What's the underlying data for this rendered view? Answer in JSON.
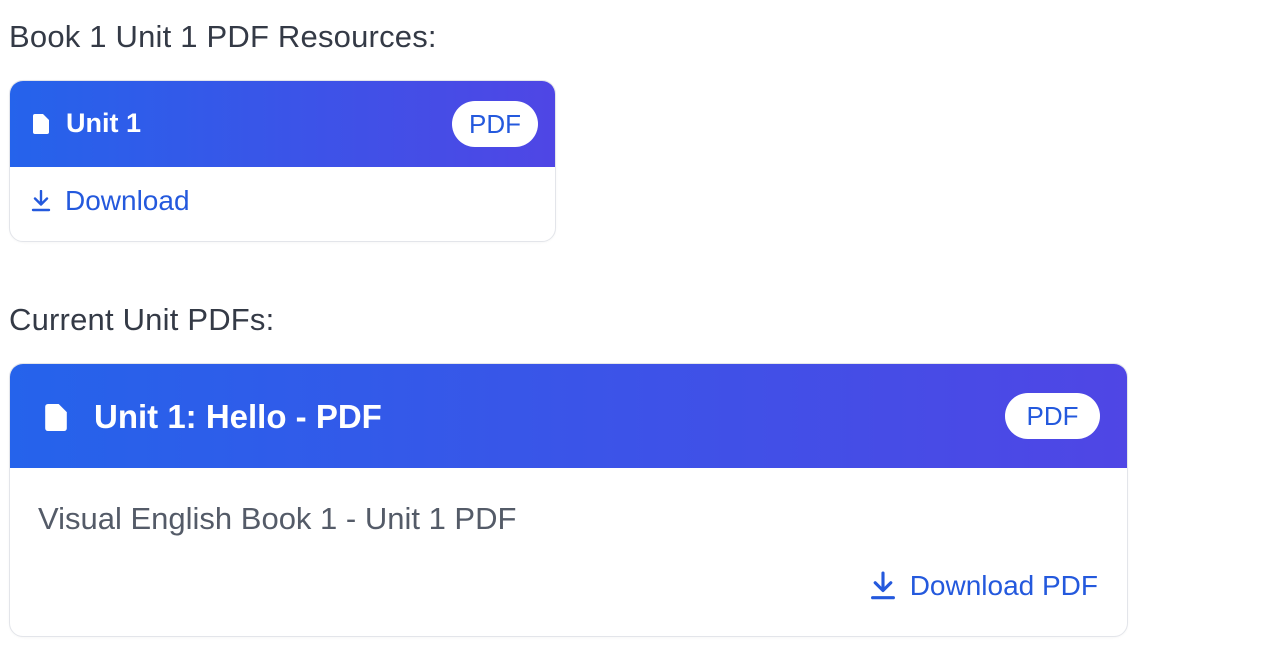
{
  "sections": [
    {
      "title": "Book 1 Unit 1 PDF Resources:",
      "card": {
        "header_title": "Unit 1",
        "badge": "PDF",
        "download_label": "Download"
      }
    },
    {
      "title": "Current Unit PDFs:",
      "card": {
        "header_title": "Unit 1: Hello - PDF",
        "badge": "PDF",
        "description": "Visual English Book 1 - Unit 1 PDF",
        "download_label": "Download PDF"
      }
    }
  ],
  "icons": {
    "file": "file-icon",
    "download": "download-icon"
  },
  "colors": {
    "header_gradient_start": "#2563eb",
    "header_gradient_end": "#4f46e5",
    "link": "#2459dd",
    "heading_text": "#343a46",
    "body_text": "#545b68"
  }
}
